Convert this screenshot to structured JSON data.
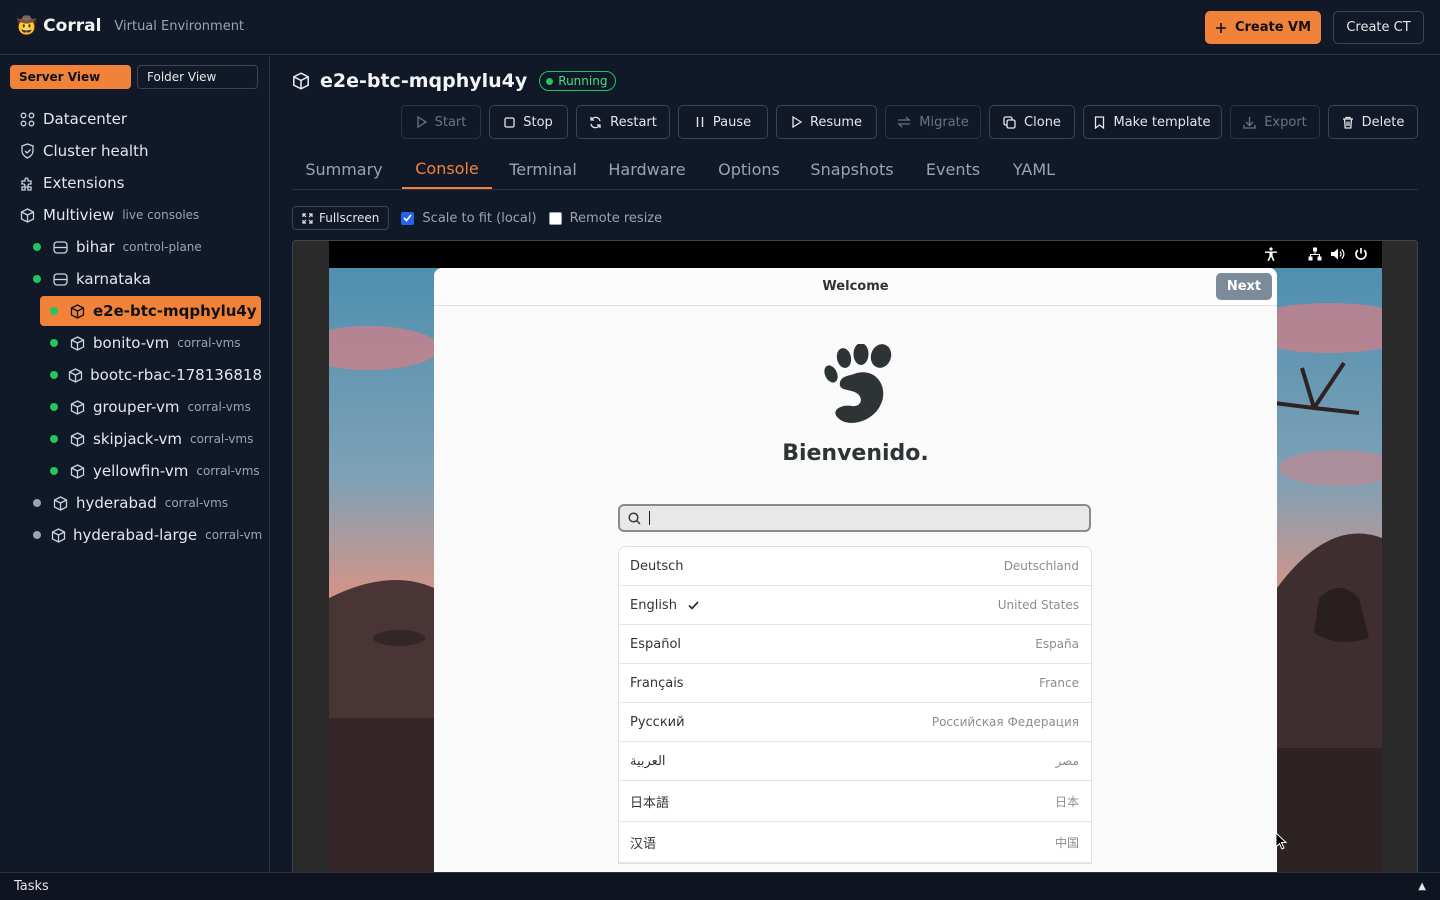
{
  "app": {
    "logo": "🤠",
    "name": "Corral",
    "subtitle": "Virtual Environment"
  },
  "topbar": {
    "create_vm": "Create VM",
    "create_ct": "Create CT",
    "accent_color": "#f0823a"
  },
  "sidebar": {
    "views": [
      "Server View",
      "Folder View"
    ],
    "nav": [
      {
        "label": "Datacenter",
        "icon": "grid-icon"
      },
      {
        "label": "Cluster health",
        "icon": "shield-icon"
      },
      {
        "label": "Extensions",
        "icon": "puzzle-icon"
      },
      {
        "label": "Multiview",
        "sub": "live consoles",
        "icon": "cube-icon"
      }
    ],
    "nodes": [
      {
        "label": "bihar",
        "sub": "control-plane",
        "status": "online"
      },
      {
        "label": "karnataka",
        "status": "online"
      }
    ],
    "vms": [
      {
        "label": "e2e-btc-mqphylu4y",
        "selected": true
      },
      {
        "label": "bonito-vm",
        "sub": "corral-vms"
      },
      {
        "label": "bootc-rbac-178136818"
      },
      {
        "label": "grouper-vm",
        "sub": "corral-vms"
      },
      {
        "label": "skipjack-vm",
        "sub": "corral-vms"
      },
      {
        "label": "yellowfin-vm",
        "sub": "corral-vms"
      }
    ],
    "others": [
      {
        "label": "hyderabad",
        "sub": "corral-vms"
      },
      {
        "label": "hyderabad-large",
        "sub": "corral-vms"
      }
    ]
  },
  "vm": {
    "name": "e2e-btc-mqphylu4y",
    "status": "Running"
  },
  "actions": [
    "Start",
    "Stop",
    "Restart",
    "Pause",
    "Resume",
    "Migrate",
    "Clone",
    "Make template",
    "Export",
    "Delete"
  ],
  "tabs": [
    "Summary",
    "Console",
    "Terminal",
    "Hardware",
    "Options",
    "Snapshots",
    "Events",
    "YAML"
  ],
  "active_tab": "Console",
  "console": {
    "fullscreen": "Fullscreen",
    "scale": "Scale to fit (local)",
    "scale_checked": true,
    "remote": "Remote resize",
    "remote_checked": false
  },
  "guest": {
    "dialog_title": "Welcome",
    "next": "Next",
    "greeting": "Bienvenido.",
    "languages": [
      {
        "name": "Deutsch",
        "region": "Deutschland"
      },
      {
        "name": "English",
        "region": "United States",
        "selected": true
      },
      {
        "name": "Español",
        "region": "España"
      },
      {
        "name": "Français",
        "region": "France"
      },
      {
        "name": "Русский",
        "region": "Российская Федерация"
      },
      {
        "name": "العربية",
        "region": "مصر"
      },
      {
        "name": "日本語",
        "region": "日本"
      },
      {
        "name": "汉语",
        "region": "中国"
      }
    ]
  },
  "footer": {
    "tasks": "Tasks",
    "toggle": "▲"
  }
}
